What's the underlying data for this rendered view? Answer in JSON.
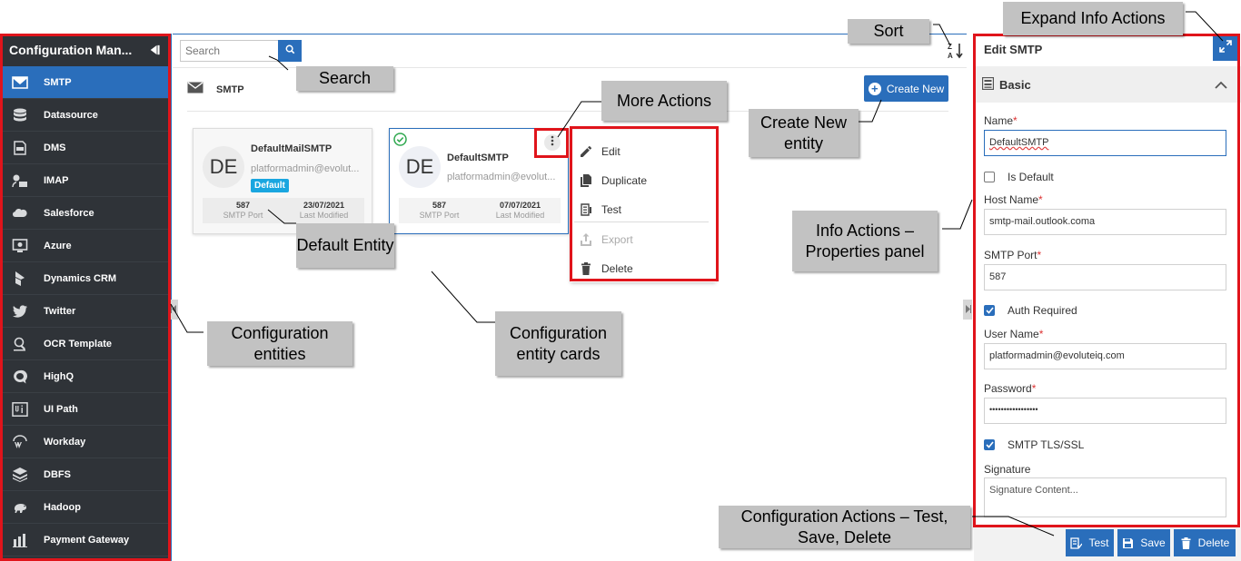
{
  "sidebar": {
    "title": "Configuration Man...",
    "items": [
      {
        "label": "SMTP",
        "icon": "envelope-icon"
      },
      {
        "label": "Datasource",
        "icon": "database-icon"
      },
      {
        "label": "DMS",
        "icon": "dms-icon"
      },
      {
        "label": "IMAP",
        "icon": "imap-icon"
      },
      {
        "label": "Salesforce",
        "icon": "salesforce-icon"
      },
      {
        "label": "Azure",
        "icon": "azure-icon"
      },
      {
        "label": "Dynamics CRM",
        "icon": "dynamics-icon"
      },
      {
        "label": "Twitter",
        "icon": "twitter-icon"
      },
      {
        "label": "OCR Template",
        "icon": "ocr-icon"
      },
      {
        "label": "HighQ",
        "icon": "highq-icon"
      },
      {
        "label": "UI Path",
        "icon": "uipath-icon"
      },
      {
        "label": "Workday",
        "icon": "workday-icon"
      },
      {
        "label": "DBFS",
        "icon": "dbfs-icon"
      },
      {
        "label": "Hadoop",
        "icon": "hadoop-icon"
      },
      {
        "label": "Payment Gateway",
        "icon": "payment-icon"
      }
    ]
  },
  "main": {
    "search_placeholder": "Search",
    "section_label": "SMTP",
    "create_label": "Create New",
    "cards": [
      {
        "avatar": "DE",
        "title": "DefaultMailSMTP",
        "email": "platformadmin@evolut...",
        "badge": "Default",
        "port": "587",
        "port_label": "SMTP Port",
        "modified": "23/07/2021",
        "modified_label": "Last Modified"
      },
      {
        "avatar": "DE",
        "title": "DefaultSMTP",
        "email": "platformadmin@evolut...",
        "port": "587",
        "port_label": "SMTP Port",
        "modified": "07/07/2021",
        "modified_label": "Last Modified"
      }
    ],
    "menu": [
      {
        "label": "Edit",
        "icon": "pencil-icon",
        "enabled": true
      },
      {
        "label": "Duplicate",
        "icon": "duplicate-icon",
        "enabled": true
      },
      {
        "label": "Test",
        "icon": "test-icon",
        "enabled": true
      },
      {
        "label": "Export",
        "icon": "export-icon",
        "enabled": false
      },
      {
        "label": "Delete",
        "icon": "trash-icon",
        "enabled": true
      }
    ]
  },
  "panel": {
    "title": "Edit SMTP",
    "section": "Basic",
    "name_label": "Name",
    "name_value": "DefaultSMTP",
    "is_default_label": "Is Default",
    "is_default": false,
    "host_label": "Host Name",
    "host_value": "smtp-mail.outlook.coma",
    "port_label": "SMTP Port",
    "port_value": "587",
    "auth_label": "Auth Required",
    "auth_checked": true,
    "user_label": "User Name",
    "user_value": "platformadmin@evoluteiq.com",
    "password_label": "Password",
    "password_value": "•••••••••••••••••",
    "tls_label": "SMTP TLS/SSL",
    "tls_checked": true,
    "signature_label": "Signature",
    "signature_placeholder": "Signature Content...",
    "required_mark": "*"
  },
  "actions": {
    "test": "Test",
    "save": "Save",
    "delete": "Delete"
  },
  "annotations": {
    "sort": "Sort",
    "expand": "Expand Info Actions",
    "search": "Search",
    "more": "More Actions",
    "create": "Create New entity",
    "default_entity": "Default Entity",
    "info_actions": "Info Actions – Properties panel",
    "config_entities": "Configuration entities",
    "entity_cards": "Configuration entity cards",
    "config_actions": "Configuration Actions – Test, Save, Delete"
  },
  "colors": {
    "accent": "#2a6ebb",
    "sidebar": "#2f3338",
    "badge": "#1aa6e0",
    "highlight": "#e0141b",
    "note": "#c2c2c2"
  }
}
